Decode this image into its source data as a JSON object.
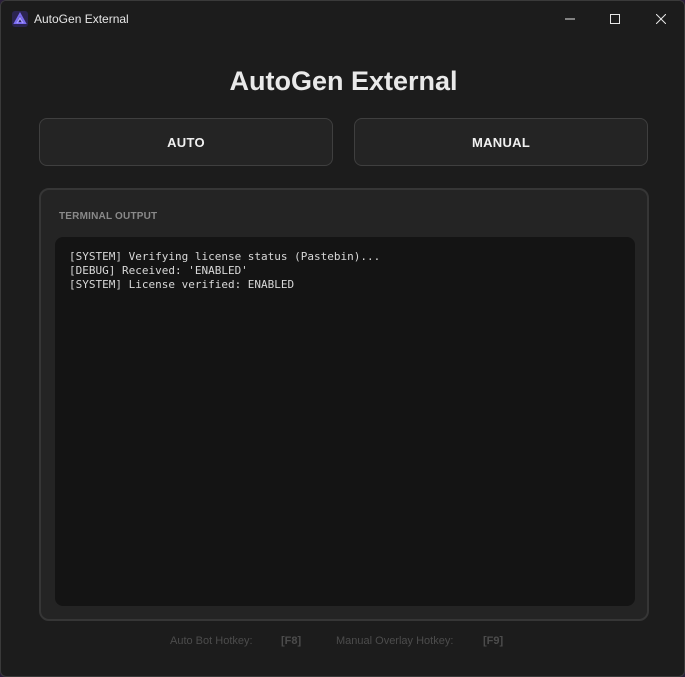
{
  "window": {
    "title": "AutoGen External",
    "controls": {
      "minimize_icon": "minimize-icon",
      "maximize_icon": "maximize-icon",
      "close_icon": "close-icon"
    }
  },
  "app": {
    "heading": "AutoGen External"
  },
  "modes": {
    "auto_label": "AUTO",
    "manual_label": "MANUAL"
  },
  "terminal": {
    "label": "TERMINAL OUTPUT",
    "lines": [
      "[SYSTEM] Verifying license status (Pastebin)...",
      "[DEBUG] Received: 'ENABLED'",
      "[SYSTEM] License verified: ENABLED"
    ]
  },
  "hotkeys": {
    "auto_label": "Auto Bot Hotkey:",
    "auto_key": "[F8]",
    "manual_label": "Manual Overlay Hotkey:",
    "manual_key": "[F9]"
  },
  "colors": {
    "window_bg": "#1c1c1c",
    "panel_bg": "#242424",
    "terminal_bg": "#141414",
    "text": "#e9e9e9",
    "muted": "#4c4c4c",
    "icon_accent": "#5a4fcf"
  }
}
